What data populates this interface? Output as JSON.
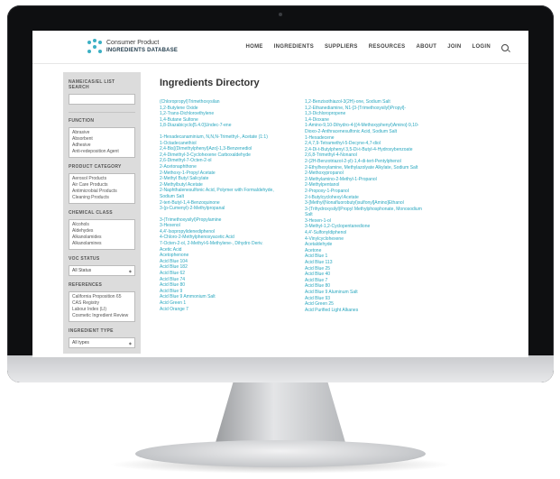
{
  "brand": {
    "line1": "Consumer Product",
    "line2": "INGREDIENTS DATABASE"
  },
  "nav": [
    "HOME",
    "INGREDIENTS",
    "SUPPLIERS",
    "RESOURCES",
    "ABOUT",
    "JOIN",
    "LOGIN"
  ],
  "page_title": "Ingredients Directory",
  "sidebar": {
    "search": {
      "heading": "NAME/CAS/EL LIST SEARCH",
      "value": ""
    },
    "function": {
      "heading": "FUNCTION",
      "options": [
        "Abrasive",
        "Absorbent",
        "Adhesive",
        "Anti-redeposition Agent"
      ]
    },
    "product_category": {
      "heading": "PRODUCT CATEGORY",
      "options": [
        "Aerosol Products",
        "Air Care Products",
        "Antimicrobial Products",
        "Cleaning Products"
      ]
    },
    "chemical_class": {
      "heading": "CHEMICAL CLASS",
      "options": [
        "Alcohols",
        "Aldehydes",
        "Alkanolamides",
        "Alkanolamines"
      ]
    },
    "voc_status": {
      "heading": "VOC STATUS",
      "value": "All Status"
    },
    "references": {
      "heading": "REFERENCES",
      "options": [
        "California Proposition 65",
        "CAS Registry",
        "Labour Index (LI)",
        "Cosmetic Ingredient Review"
      ]
    },
    "ingredient_type": {
      "heading": "INGREDIENT TYPE",
      "value": "All types"
    }
  },
  "ingredients": {
    "col1": [
      "(Chloropropyl)Trimethoxysilan",
      "1,2-Butylene Oxide",
      "1,2-Trans-Dichloroethylene",
      "1,4-Butane Sultone",
      "1,8-Diazabicyclo[5.4.0]Undec-7-ene",
      "",
      "1-Hexadecanaminium, N,N,N-Trimethyl-, Acetate (1:1)",
      "1-Octadecanethiol",
      "2,4-Bis[(Dimethylphenyl)Azo]-1,3-Benzenediol",
      "2,4-Dimethyl-3-Cyclohexene Carboxaldehyde",
      "2,6-Dimethyl-7-Octen-2-ol",
      "2-Acetonaphthone",
      "2-Methoxy-1-Propyl Acetate",
      "2-Methyl Butyl Salicylate",
      "2-Methylbutyl Acetate",
      "2-Naphthalenesulfonic Acid, Polymer with Formaldehyde,",
      "Sodium Salt",
      "2-tert-Butyl-1,4-Benzoquinone",
      "3-(p-Cumenyl)-2-Methylpropanal",
      "",
      "3-(Trimethoxysilyl)Propylamine",
      "3-Hexenol",
      "4,4'-Isopropylidenediphenol",
      "4-Chloro-2-Methylphenoxyacetic Acid",
      "7-Octen-2-ol, 2-Methyl-6-Methylene-, Dihydro Deriv.",
      "Acetic Acid",
      "Acetophenone",
      "Acid Blue 104",
      "Acid Blue 182",
      "Acid Blue 62",
      "Acid Blue 74",
      "Acid Blue 80",
      "Acid Blue 9",
      "Acid Blue 9 Ammonium Salt",
      "Acid Green 1",
      "Acid Orange 7"
    ],
    "col2": [
      "1,2-Benzisothiazol-3(2H)-one, Sodium Salt",
      "1,2-Ethanediamine, N1-[3-(Trimethoxysilyl)Propyl]-",
      "1,3-Dichloropropene",
      "1,4-Dioxane",
      "1-Amino-9,10-Dihydro-4-[(4-Methoxyphenyl)Amino]-9,10-",
      "Dioxo-2-Anthracenesulfonic Acid, Sodium Salt",
      "1-Hexadecene",
      "2,4,7,9-Tetramethyl-5-Decyne-4,7-diol",
      "2,4-Di-t-Butylphenyl 3,5-Di-t-Butyl-4-Hydroxybenzoate",
      "2,6,8-Trimethyl-4-Nonanol",
      "2-(2H-Benzotriazol-2-yl)-1,4-di-tert-Pentylphenol",
      "2-Ethylhexylamine, Methylazolyate Alkylate, Sodium Salt",
      "2-Methoxypropanol",
      "2-Methylamino-2-Methyl-1-Propanol",
      "2-Methylpentanol",
      "2-Propoxy-1-Propanol",
      "2-t-Butylcyclohexyl Acetate",
      "3-[Methyl(Nonafluorobutyl)sulfonyl]Amino]Ethanol",
      "3-(Trihydroxysilyl)Propyl Methylphosphonate, Monosodium",
      "Salt",
      "3-Hexen-1-ol",
      "3-Methyl-1,2-Cyclopentanedione",
      "4,4'-Sulfonyldiphenol",
      "4-Vinylcyclohexene",
      "Acetaldehyde",
      "Acetone",
      "Acid Blue 1",
      "Acid Blue 113",
      "Acid Blue 25",
      "Acid Blue 40",
      "Acid Blue 7",
      "Acid Blue 80",
      "Acid Blue 9 Aluminum Salt",
      "Acid Blue 93",
      "Acid Green 25",
      "Acid Purified Light Alkanes"
    ]
  }
}
